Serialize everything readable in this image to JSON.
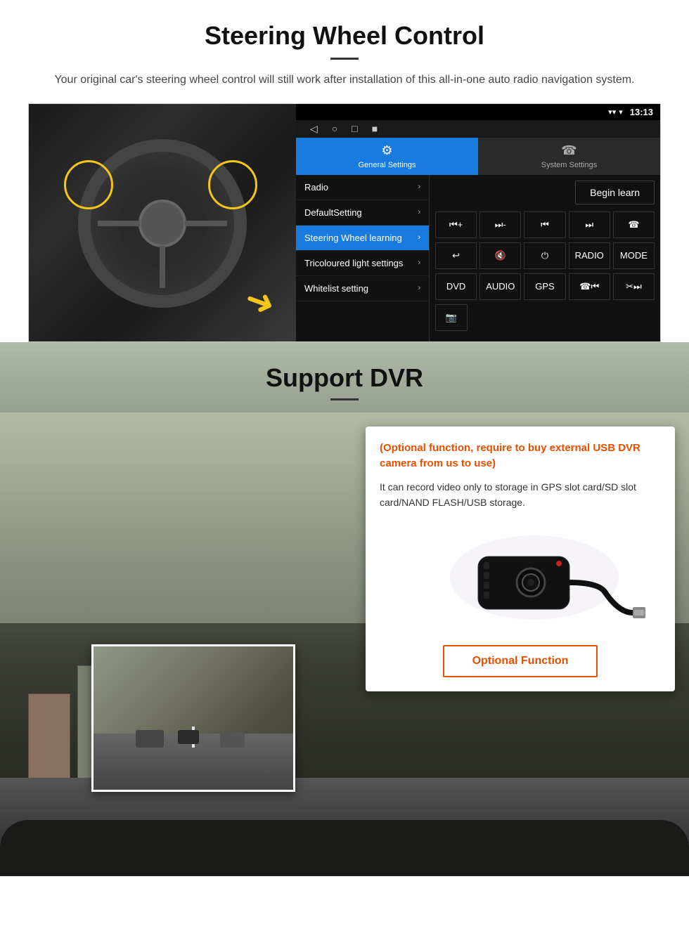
{
  "steering": {
    "title": "Steering Wheel Control",
    "subtitle": "Your original car's steering wheel control will still work after installation of this all-in-one auto radio navigation system.",
    "statusbar": {
      "time": "13:13",
      "icons": [
        "▾",
        "▾",
        "♦"
      ]
    },
    "nav_buttons": [
      "◁",
      "○",
      "□",
      "■"
    ],
    "tabs": [
      {
        "icon": "⚙",
        "label": "General Settings",
        "active": true
      },
      {
        "icon": "☎",
        "label": "System Settings",
        "active": false
      }
    ],
    "menu_items": [
      {
        "label": "Radio",
        "active": false
      },
      {
        "label": "DefaultSetting",
        "active": false
      },
      {
        "label": "Steering Wheel learning",
        "active": true
      },
      {
        "label": "Tricoloured light settings",
        "active": false
      },
      {
        "label": "Whitelist setting",
        "active": false
      }
    ],
    "begin_learn": "Begin learn",
    "control_rows": [
      [
        "⏮+",
        "⏭-",
        "⏮",
        "⏭",
        "☎"
      ],
      [
        "↩",
        "🔇",
        "⏻",
        "RADIO",
        "MODE"
      ],
      [
        "DVD",
        "AUDIO",
        "GPS",
        "☎⏮",
        "✂⏭"
      ],
      [
        "📷"
      ]
    ]
  },
  "dvr": {
    "title": "Support DVR",
    "optional_text": "(Optional function, require to buy external USB DVR camera from us to use)",
    "description": "It can record video only to storage in GPS slot card/SD slot card/NAND FLASH/USB storage.",
    "optional_button": "Optional Function"
  }
}
